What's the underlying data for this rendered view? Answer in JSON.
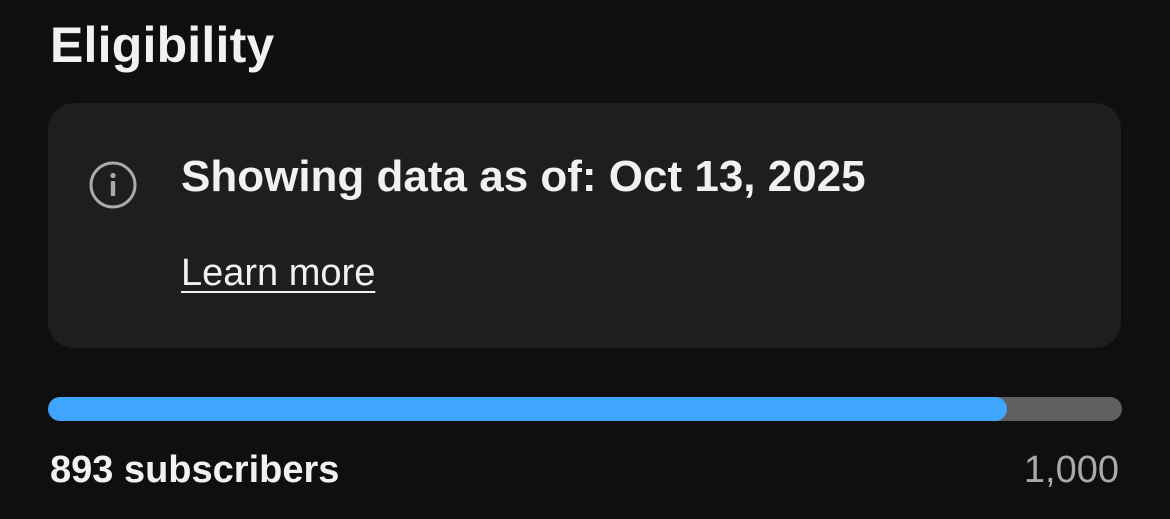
{
  "section": {
    "title": "Eligibility"
  },
  "notice": {
    "icon": "info-icon",
    "text": "Showing data as of: Oct 13, 2025",
    "link_label": "Learn more"
  },
  "progress": {
    "current_label": "893 subscribers",
    "goal_label": "1,000",
    "current_value": 893,
    "goal_value": 1000,
    "fill_color": "#3ea6ff",
    "track_color": "#5f5f5f"
  }
}
